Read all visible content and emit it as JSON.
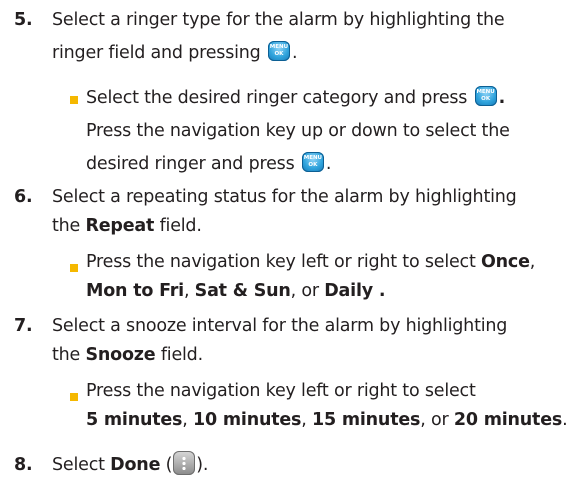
{
  "steps": [
    {
      "number": "5.",
      "line1": "Select a ringer type for the alarm by highlighting the",
      "line2_before_key": "ringer field and pressing",
      "line2_after_key": ".",
      "sub": {
        "line1_before_key": "Select the desired ringer category and press",
        "line1_after_key": ".",
        "line2": "Press the navigation key up or down to select the",
        "line3_before_key": "desired ringer and press",
        "line3_after_key": "."
      }
    },
    {
      "number": "6.",
      "line1": "Select a repeating status for the alarm by highlighting",
      "line2_before": "the ",
      "line2_bold": "Repeat",
      "line2_after": " field.",
      "sub": {
        "line1_text": "Press the navigation key left or right to select ",
        "opt1": "Once",
        "sep1": ",",
        "opt2": "Mon to Fri",
        "sep2": ", ",
        "opt3": "Sat & Sun",
        "sep3": ", or ",
        "opt4": "Daily .",
        "sep4": ""
      }
    },
    {
      "number": "7.",
      "line1": "Select a snooze interval for the alarm by highlighting",
      "line2_before": "the ",
      "line2_bold": "Snooze",
      "line2_after": " field.",
      "sub": {
        "line1": "Press the navigation key left or right to select",
        "opt1": "5 minutes",
        "sep1": ", ",
        "opt2": "10 minutes",
        "sep2": ", ",
        "opt3": "15 minutes",
        "sep3": ", or ",
        "opt4": "20 minutes",
        "end": "."
      }
    },
    {
      "number": "8.",
      "before": "Select ",
      "bold": "Done",
      "paren_open": " (",
      "paren_close": ")."
    }
  ],
  "menu_key": {
    "top": "MENU",
    "bottom": "OK",
    "icon": "menu-ok-key-icon"
  },
  "softkey": {
    "icon": "softkey-icon"
  },
  "colors": {
    "bullet": "#f5b800",
    "key": "#2fa3dc",
    "text": "#231f20"
  }
}
